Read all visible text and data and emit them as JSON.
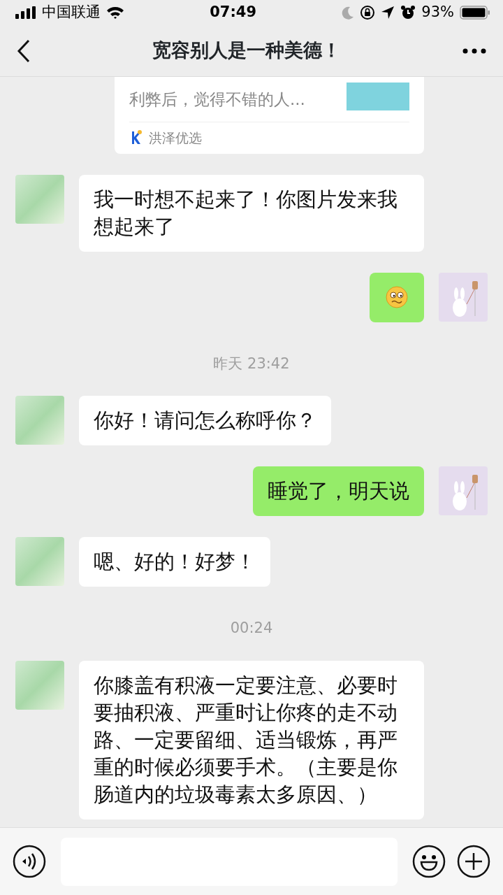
{
  "status_bar": {
    "carrier": "中国联通",
    "time": "07:49",
    "battery": "93%"
  },
  "header": {
    "title": "宽容别人是一种美德！"
  },
  "messages": [
    {
      "kind": "card",
      "text": "利弊后，觉得不错的人...",
      "source": "洪泽优选"
    },
    {
      "kind": "text",
      "outgoing": false,
      "text": "我一时想不起来了！你图片发来我想起来了"
    },
    {
      "kind": "emoji",
      "outgoing": true
    },
    {
      "kind": "time",
      "text": "昨天 23:42"
    },
    {
      "kind": "text",
      "outgoing": false,
      "text": "你好！请问怎么称呼你？"
    },
    {
      "kind": "text",
      "outgoing": true,
      "text": "睡觉了，明天说"
    },
    {
      "kind": "text",
      "outgoing": false,
      "text": "嗯、好的！好梦！"
    },
    {
      "kind": "time",
      "text": "00:24"
    },
    {
      "kind": "text",
      "outgoing": false,
      "text": "你膝盖有积液一定要注意、必要时要抽积液、严重时让你疼的走不动路、一定要留细、适当锻炼，再严重的时候必须要手术。（主要是你肠道内的垃圾毒素太多原因、）"
    }
  ]
}
